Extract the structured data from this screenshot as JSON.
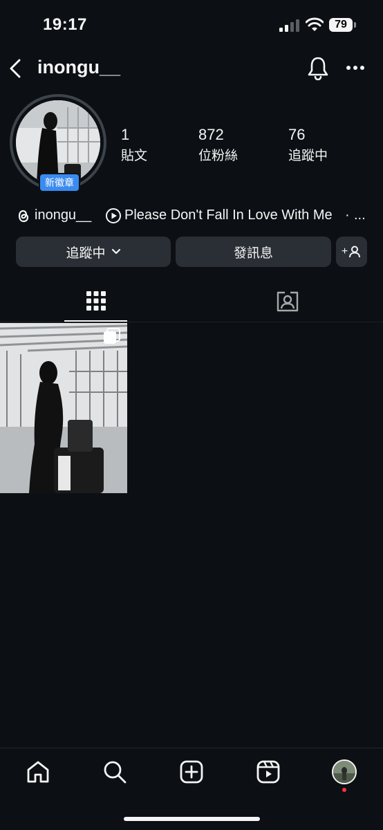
{
  "status_bar": {
    "time": "19:17",
    "battery": "79"
  },
  "header": {
    "username": "inongu__"
  },
  "profile": {
    "badge": "新徽章",
    "stats": [
      {
        "value": "1",
        "label": "貼文"
      },
      {
        "value": "872",
        "label": "位粉絲"
      },
      {
        "value": "76",
        "label": "追蹤中"
      }
    ],
    "threads_handle": "inongu__",
    "music": "Please Don't Fall In Love With Me",
    "separator": "·",
    "more": "..."
  },
  "actions": {
    "following": "追蹤中",
    "message": "發訊息",
    "add_user": "+"
  },
  "tabs": [
    {
      "icon": "grid-icon",
      "active": true
    },
    {
      "icon": "tagged-icon",
      "active": false
    }
  ],
  "posts": [
    {
      "type": "image",
      "multi": true
    }
  ],
  "bottom_nav": [
    {
      "icon": "home-icon"
    },
    {
      "icon": "search-icon"
    },
    {
      "icon": "create-icon"
    },
    {
      "icon": "reels-icon"
    },
    {
      "icon": "profile-avatar"
    }
  ],
  "colors": {
    "background": "#0c1014",
    "button": "#2a2f35",
    "badge": "#3a8bf0",
    "notification_dot": "#ff3040"
  }
}
